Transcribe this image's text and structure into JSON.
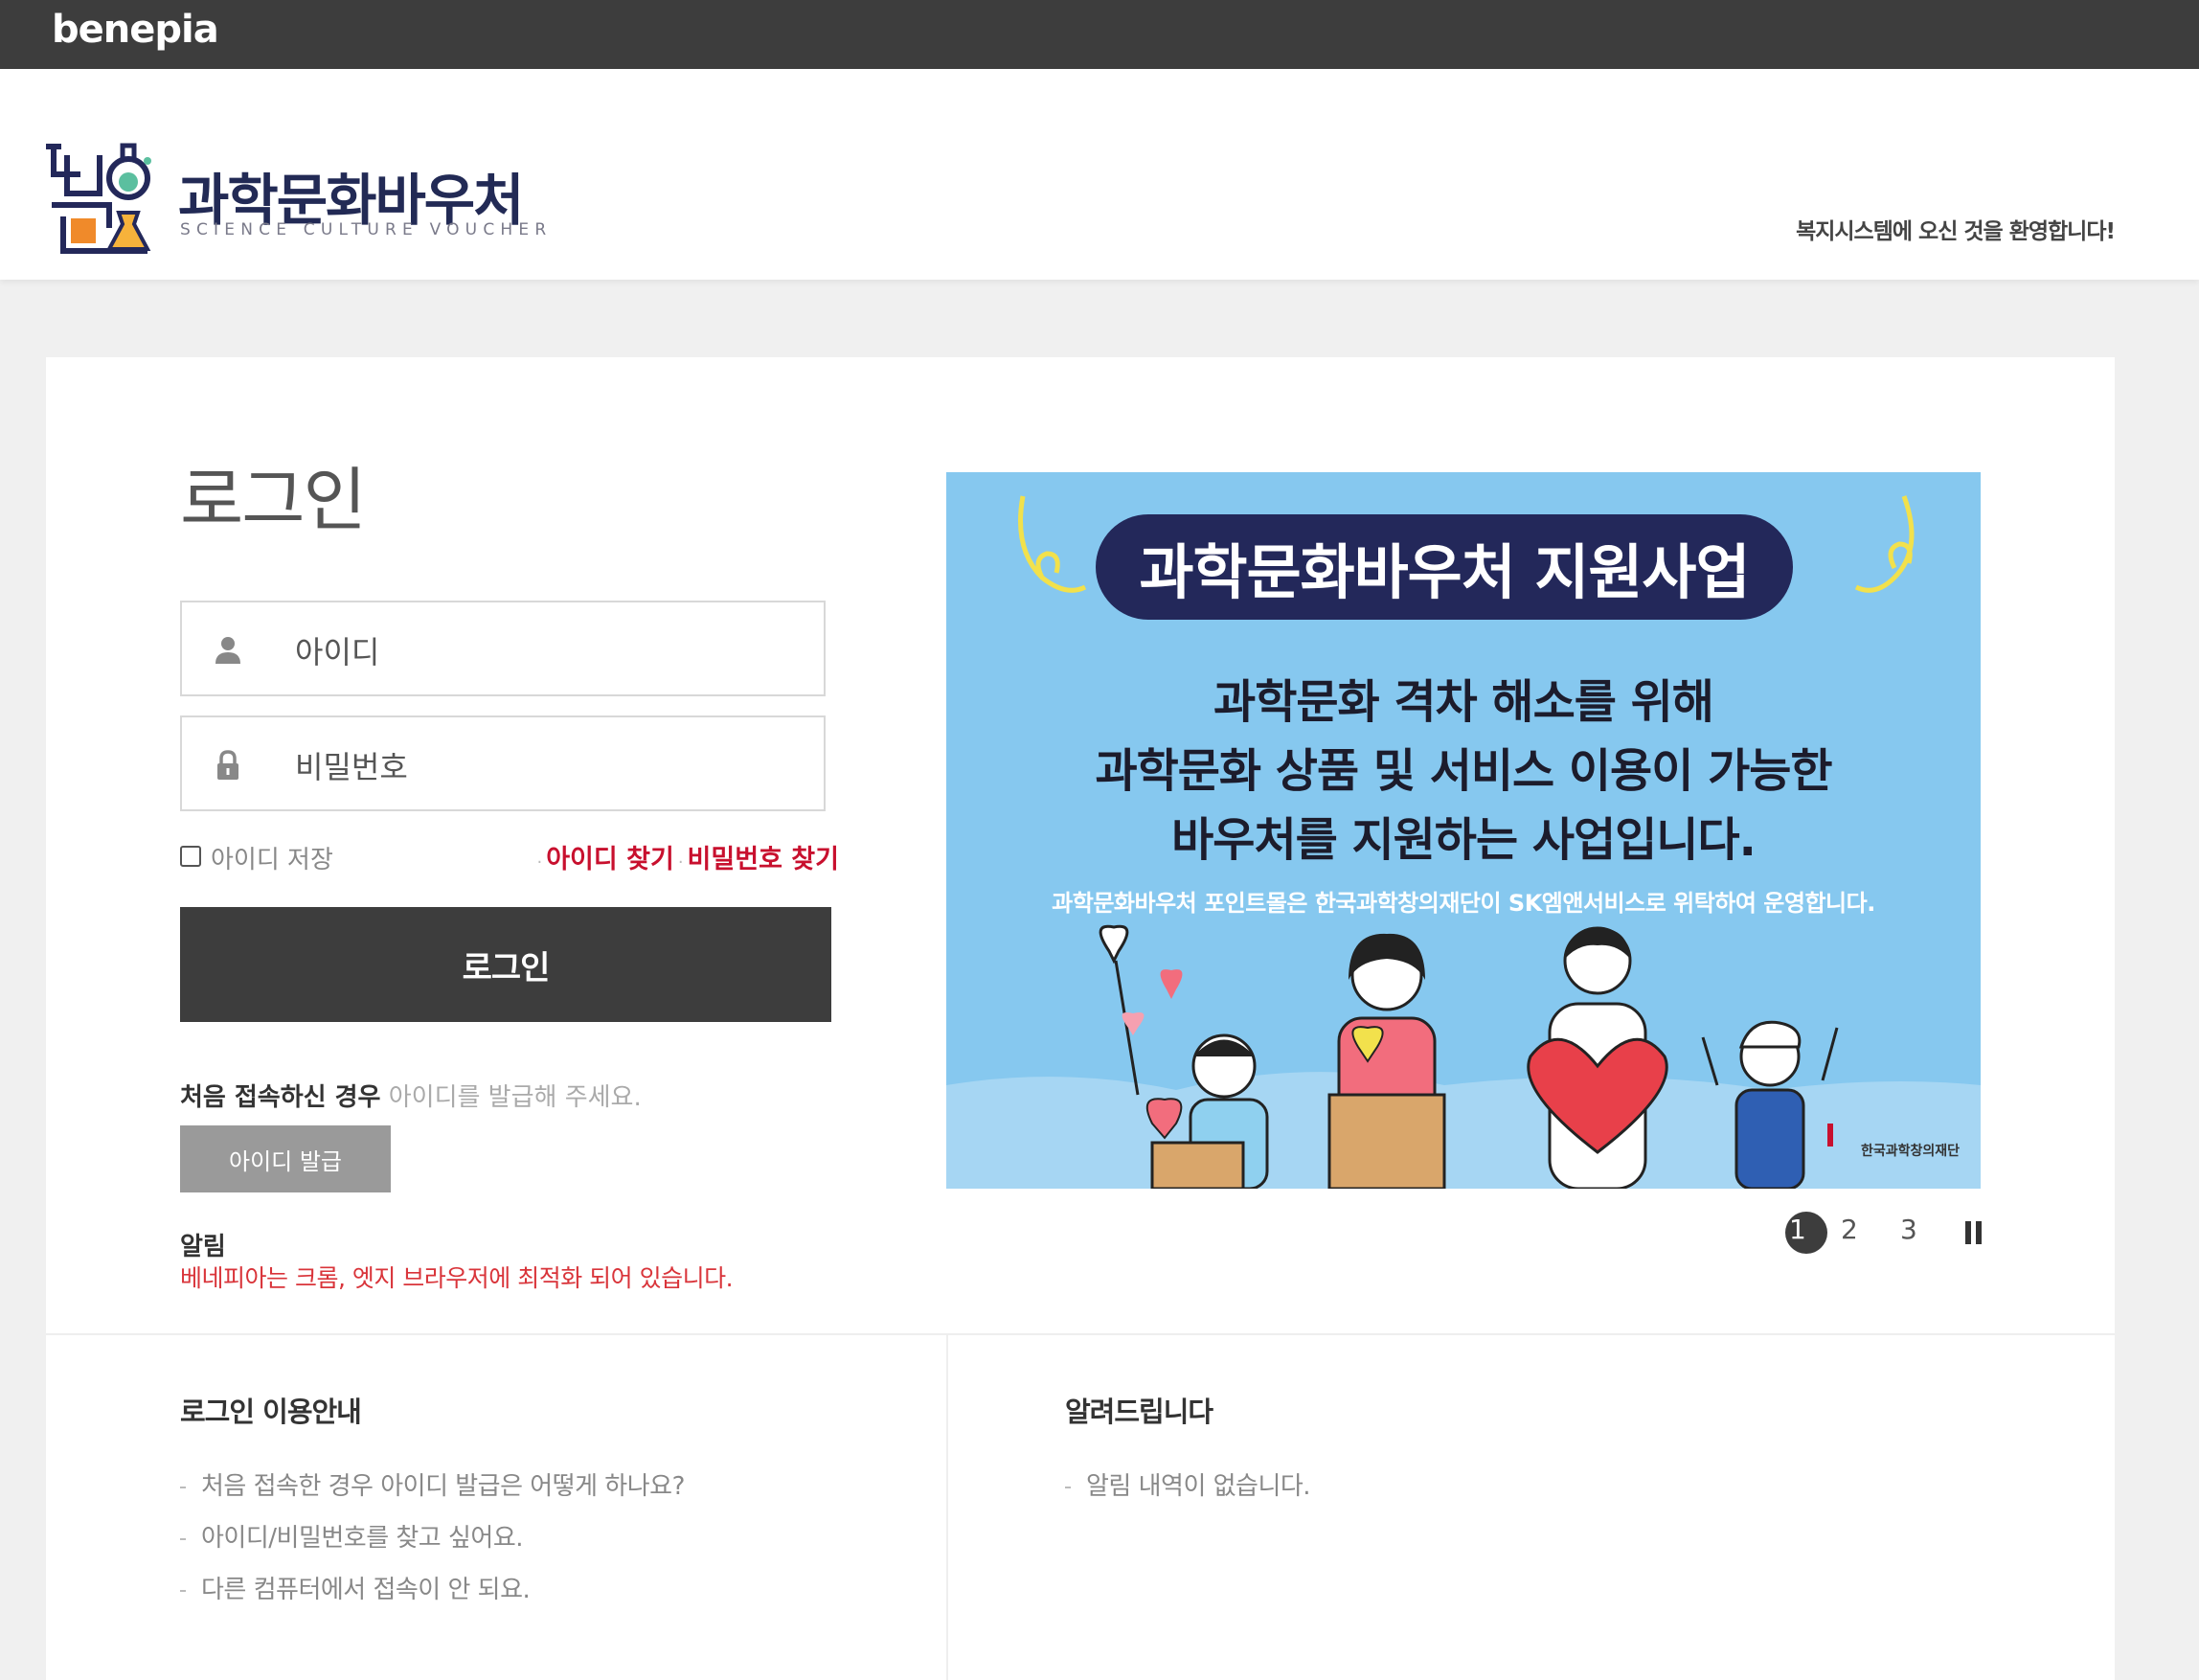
{
  "topbar": {
    "brand": "benepia"
  },
  "header": {
    "logo_title": "과학문화바우처",
    "logo_subtitle": "SCIENCE CULTURE VOUCHER",
    "welcome": "복지시스템에 오신 것을 환영합니다!"
  },
  "login": {
    "title": "로그인",
    "id_placeholder": "아이디",
    "pw_placeholder": "비밀번호",
    "save_id_label": "아이디 저장",
    "find_id": "아이디 찾기",
    "find_pw": "비밀번호 찾기",
    "login_button": "로그인",
    "first_visit_bold": "처음 접속하신 경우",
    "first_visit_light": "아이디를 발급해 주세요.",
    "issue_button": "아이디 발급",
    "notice_label": "알림",
    "notice_text": "베네피아는 크롬, 엣지 브라우저에 최적화 되어 있습니다."
  },
  "banner": {
    "title": "과학문화바우처 지원사업",
    "line1": "과학문화 격차 해소를 위해",
    "line2": "과학문화 상품 및 서비스 이용이 가능한",
    "line3": "바우처를 지원하는 사업입니다.",
    "small": "과학문화바우처 포인트몰은 한국과학창의재단이 SK엠앤서비스로 위탁하여 운영합니다.",
    "brand": "한국과학창의재단",
    "pager": {
      "current": "1",
      "page2": "2",
      "page3": "3"
    }
  },
  "guide": {
    "title": "로그인 이용안내",
    "items": [
      "처음 접속한 경우 아이디 발급은 어떻게 하나요?",
      "아이디/비밀번호를 찾고 싶어요.",
      "다른 컴퓨터에서 접속이 안 되요."
    ]
  },
  "notices": {
    "title": "알려드립니다",
    "empty": "알림 내역이 없습니다."
  },
  "colors": {
    "topbar": "#3d3d3d",
    "accent_red": "#c8102e",
    "banner_bg": "#86c8ef",
    "banner_pill": "#23285a"
  }
}
